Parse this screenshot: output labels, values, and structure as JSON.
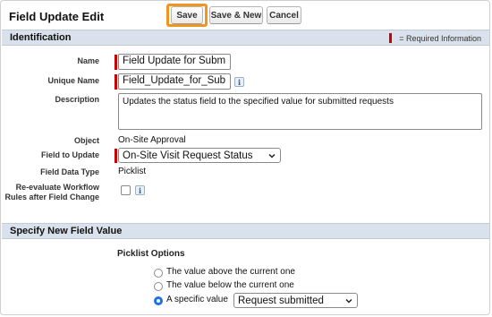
{
  "header": {
    "title": "Field Update Edit",
    "save_label": "Save",
    "save_new_label": "Save & New",
    "cancel_label": "Cancel"
  },
  "identification": {
    "section_title": "Identification",
    "required_legend": "= Required Information",
    "name_label": "Name",
    "name_value": "Field Update for Subm",
    "unique_name_label": "Unique Name",
    "unique_name_value": "Field_Update_for_Sub",
    "description_label": "Description",
    "description_value": "Updates the status field to the specified value for submitted requests",
    "object_label": "Object",
    "object_value": "On-Site Approval",
    "field_to_update_label": "Field to Update",
    "field_to_update_value": "On-Site Visit Request Status",
    "field_data_type_label": "Field Data Type",
    "field_data_type_value": "Picklist",
    "reevaluate_label": "Re-evaluate Workflow Rules after Field Change",
    "reevaluate_checked": false
  },
  "new_value": {
    "section_title": "Specify New Field Value",
    "picklist_options_label": "Picklist Options",
    "options": [
      {
        "label": "The value above the current one",
        "selected": false
      },
      {
        "label": "The value below the current one",
        "selected": false
      },
      {
        "label": "A specific value",
        "selected": true
      }
    ],
    "specific_value": "Request submitted"
  },
  "colors": {
    "accent_highlight": "#f0951f",
    "required_bar": "#cc0000",
    "section_bg": "#d9e2ec",
    "radio_selected": "#1a73e8"
  },
  "icons": {
    "info": "info-icon",
    "dropdown": "chevron-down-icon"
  }
}
